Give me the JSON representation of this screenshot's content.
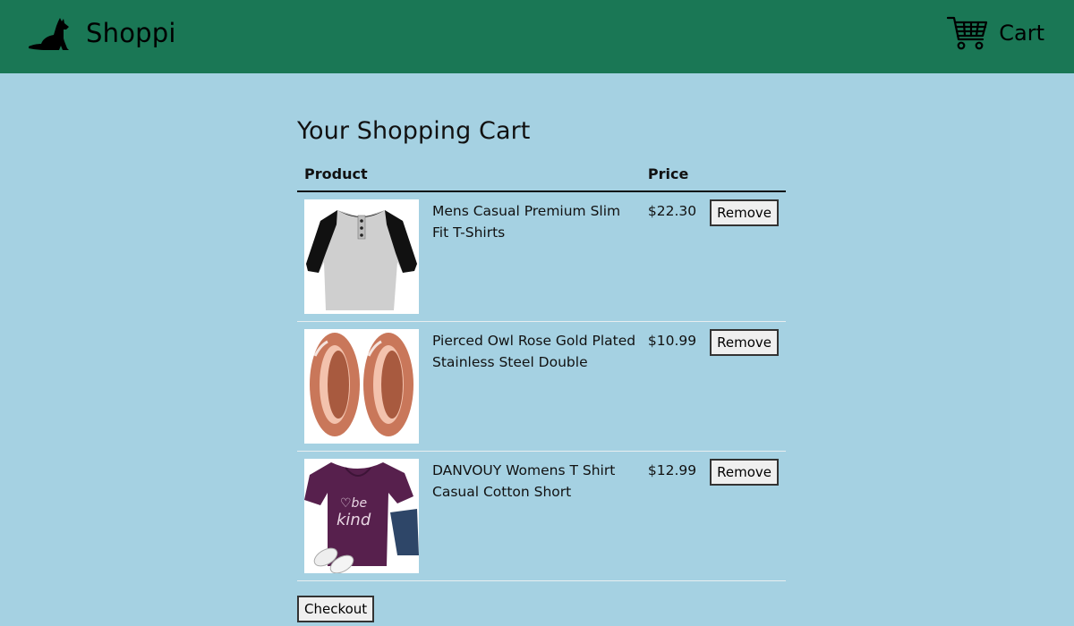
{
  "header": {
    "brand": "Shoppi",
    "cart_label": "Cart",
    "logo_icon": "dog-icon",
    "cart_icon": "shopping-cart-icon",
    "bg_color": "#1a7755"
  },
  "main": {
    "title": "Your Shopping Cart",
    "columns": [
      "Product",
      "",
      "Price",
      ""
    ],
    "items": [
      {
        "name": "Mens Casual Premium Slim Fit T-Shirts",
        "price": "$22.30",
        "remove_label": "Remove",
        "image": "gray-black-henley-tshirt"
      },
      {
        "name": "Pierced Owl Rose Gold Plated Stainless Steel Double",
        "price": "$10.99",
        "remove_label": "Remove",
        "image": "rose-gold-ear-plugs"
      },
      {
        "name": "DANVOUY Womens T Shirt Casual Cotton Short",
        "price": "$12.99",
        "remove_label": "Remove",
        "image": "purple-be-kind-tshirt"
      }
    ],
    "checkout_label": "Checkout"
  },
  "colors": {
    "page_bg": "#a5d1e2",
    "accent": "#1a7755"
  }
}
